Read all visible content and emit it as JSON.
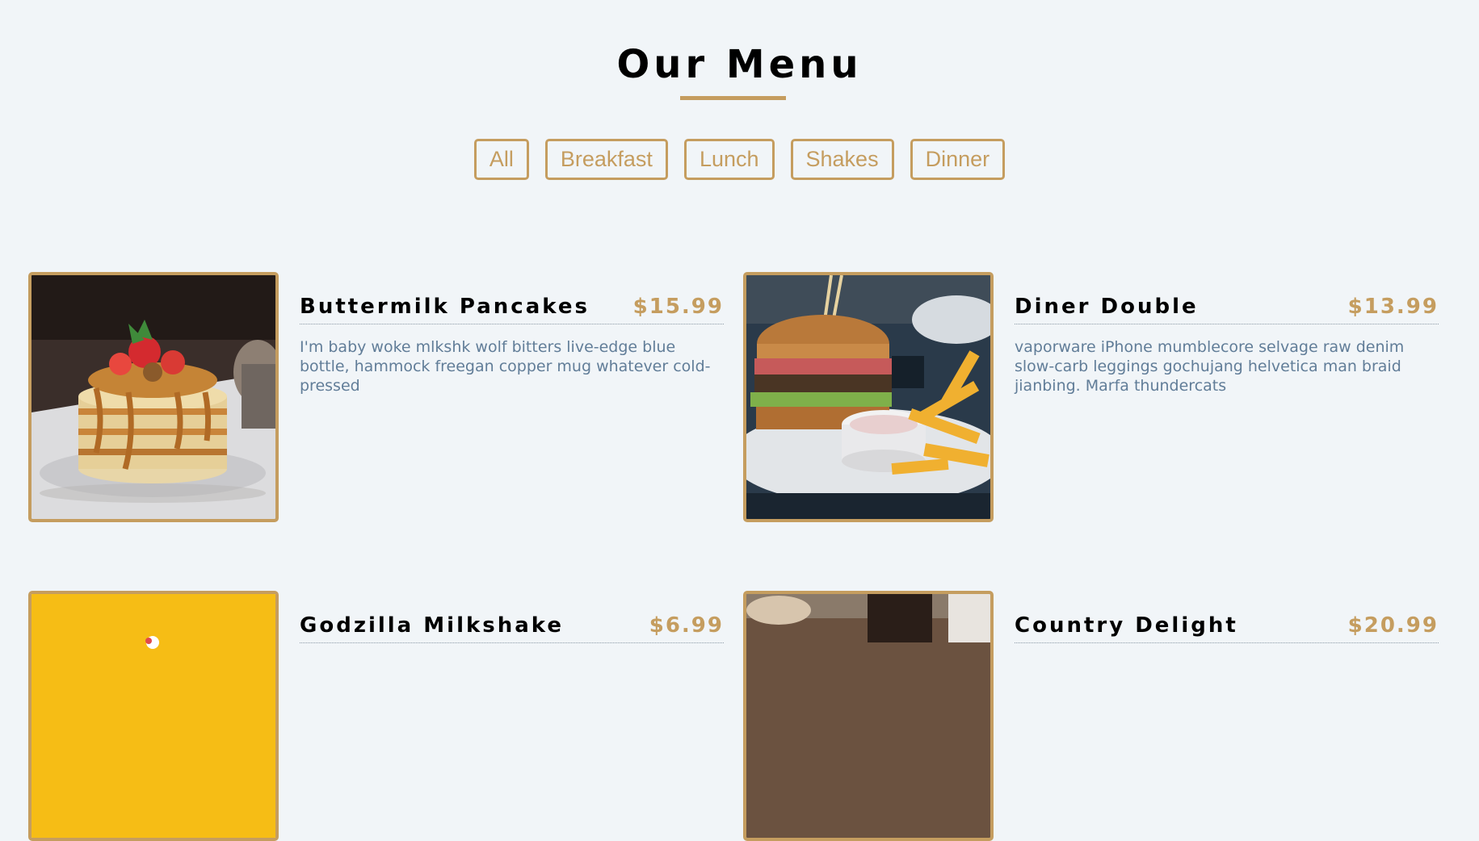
{
  "header": {
    "title": "Our Menu"
  },
  "filters": [
    {
      "label": "All"
    },
    {
      "label": "Breakfast"
    },
    {
      "label": "Lunch"
    },
    {
      "label": "Shakes"
    },
    {
      "label": "Dinner"
    }
  ],
  "menu": {
    "items": [
      {
        "name": "Buttermilk Pancakes",
        "price": "$15.99",
        "description": "I'm baby woke mlkshk wolf bitters live-edge blue bottle, hammock freegan copper mug whatever cold-pressed",
        "image": "pancakes-photo"
      },
      {
        "name": "Diner Double",
        "price": "$13.99",
        "description": "vaporware iPhone mumblecore selvage raw denim slow-carb leggings gochujang helvetica man braid jianbing. Marfa thundercats",
        "image": "burger-photo"
      },
      {
        "name": "Godzilla Milkshake",
        "price": "$6.99",
        "description": "",
        "image": "milkshake-photo"
      },
      {
        "name": "Country Delight",
        "price": "$20.99",
        "description": "",
        "image": "country-delight-photo"
      }
    ]
  },
  "colors": {
    "background": "#f1f5f8",
    "accent": "#c59d5f",
    "text": "#617d98",
    "heading": "#000000"
  }
}
